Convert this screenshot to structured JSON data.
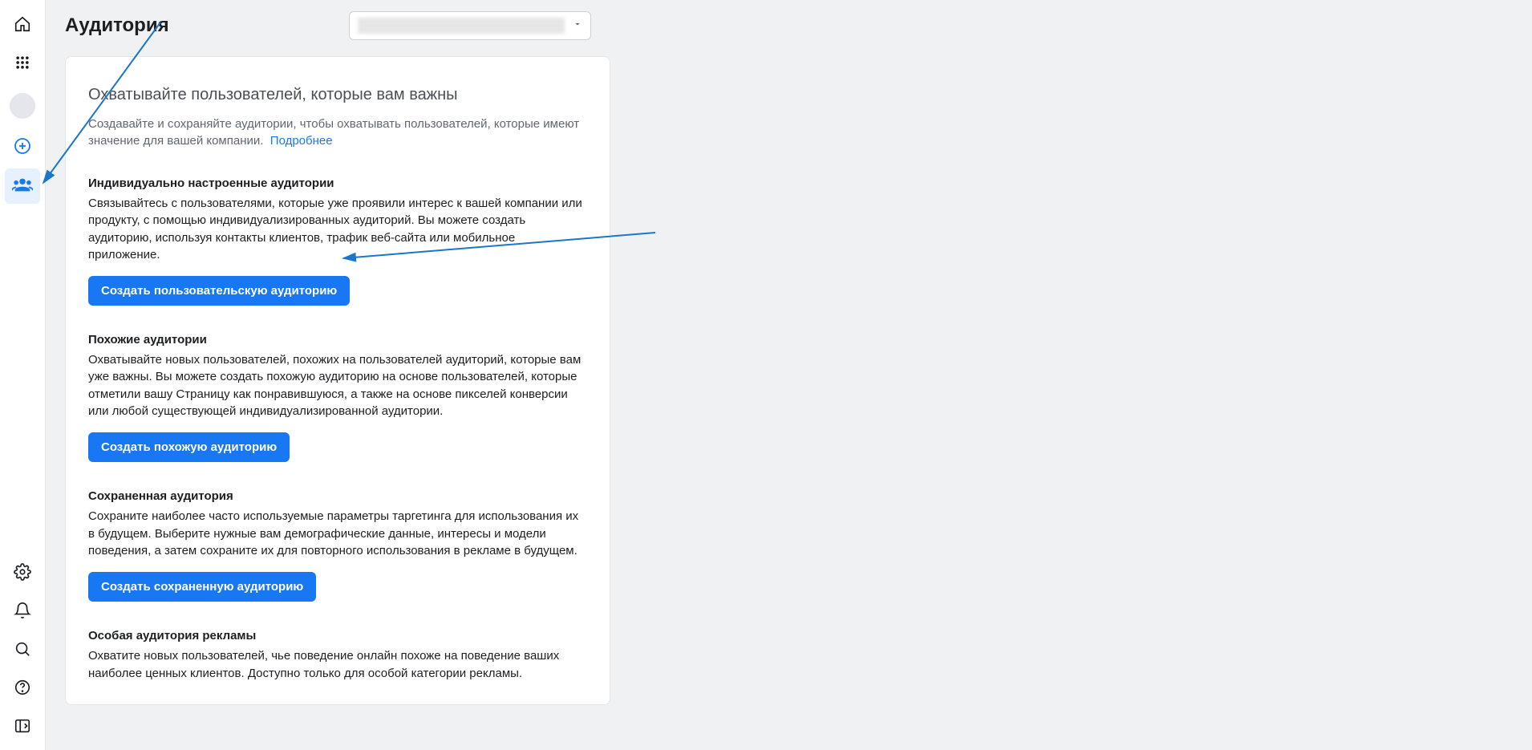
{
  "sidebar": {
    "items_top": [
      {
        "name": "home-icon"
      },
      {
        "name": "apps-grid-icon"
      },
      {
        "name": "avatar"
      },
      {
        "name": "create-plus-icon"
      },
      {
        "name": "audiences-icon"
      }
    ],
    "items_bottom": [
      {
        "name": "settings-gear-icon"
      },
      {
        "name": "notifications-bell-icon"
      },
      {
        "name": "search-icon"
      },
      {
        "name": "help-icon"
      },
      {
        "name": "collapse-panel-icon"
      }
    ],
    "active_index": 4
  },
  "header": {
    "title": "Аудитория",
    "account_selector": {
      "value_redacted": true
    }
  },
  "card": {
    "hero_title": "Охватывайте пользователей, которые вам важны",
    "hero_lead": "Создавайте и сохраняйте аудитории, чтобы охватывать пользователей, которые имеют значение для вашей компании.",
    "hero_link": "Подробнее",
    "sections": [
      {
        "title": "Индивидуально настроенные аудитории",
        "text": "Связывайтесь с пользователями, которые уже проявили интерес к вашей компании или продукту, с помощью индивидуализированных аудиторий. Вы можете создать аудиторию, используя контакты клиентов, трафик веб-сайта или мобильное приложение.",
        "button": "Создать пользовательскую аудиторию"
      },
      {
        "title": "Похожие аудитории",
        "text": "Охватывайте новых пользователей, похожих на пользователей аудиторий, которые вам уже важны. Вы можете создать похожую аудиторию на основе пользователей, которые отметили вашу Страницу как понравившуюся, а также на основе пикселей конверсии или любой существующей индивидуализированной аудитории.",
        "button": "Создать похожую аудиторию"
      },
      {
        "title": "Сохраненная аудитория",
        "text": "Сохраните наиболее часто используемые параметры таргетинга для использования их в будущем. Выберите нужные вам демографические данные, интересы и модели поведения, а затем сохраните их для повторного использования в рекламе в будущем.",
        "button": "Создать сохраненную аудиторию"
      },
      {
        "title": "Особая аудитория рекламы",
        "text": "Охватите новых пользователей, чье поведение онлайн похоже на поведение ваших наиболее ценных клиентов. Доступно только для особой категории рекламы.",
        "button": ""
      }
    ]
  },
  "annotation": {
    "arrows": [
      {
        "from": "top-right",
        "to": "title-area"
      },
      {
        "from": "right",
        "to": "create-custom-button"
      }
    ]
  }
}
